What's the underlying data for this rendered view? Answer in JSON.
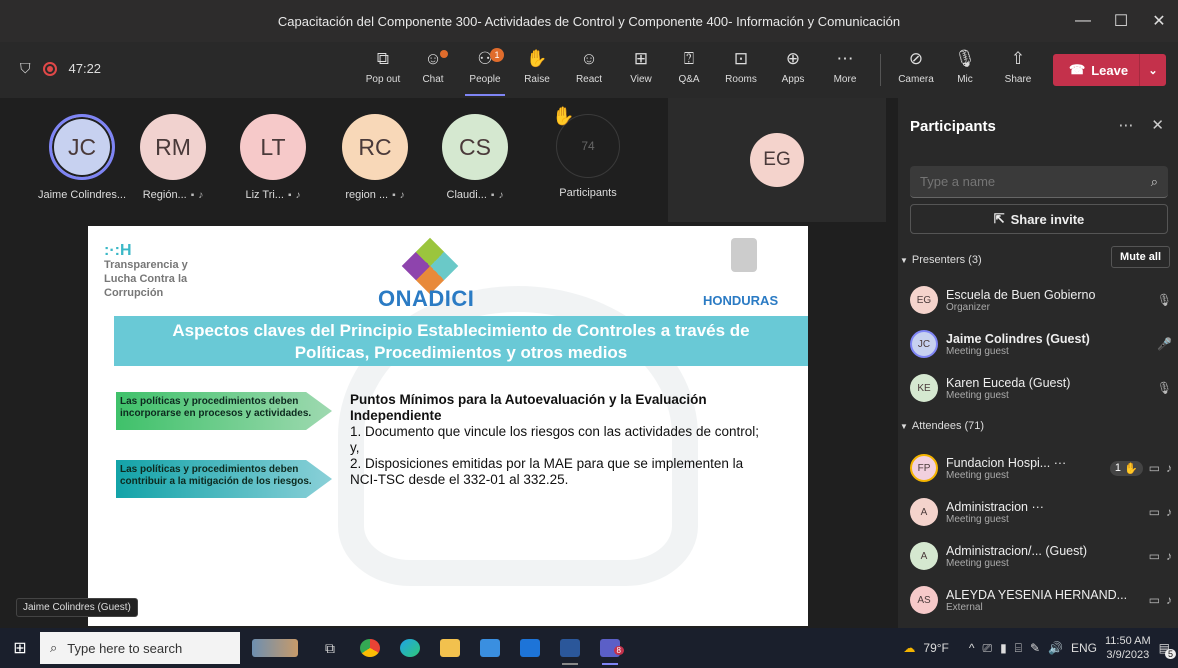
{
  "window": {
    "title": "Capacitación del Componente 300- Actividades de Control y Componente 400- Información y Comunicación",
    "controls": [
      "—",
      "☐",
      "✕"
    ]
  },
  "toolbar": {
    "timer": "47:22",
    "buttons": [
      {
        "label": "Pop out",
        "icon": "pop-out-icon"
      },
      {
        "label": "Chat",
        "icon": "chat-icon"
      },
      {
        "label": "People",
        "icon": "people-icon",
        "badge": "1"
      },
      {
        "label": "Raise",
        "icon": "raise-hand-icon"
      },
      {
        "label": "React",
        "icon": "react-icon"
      },
      {
        "label": "View",
        "icon": "view-icon"
      },
      {
        "label": "Q&A",
        "icon": "qa-icon"
      },
      {
        "label": "Rooms",
        "icon": "rooms-icon"
      },
      {
        "label": "Apps",
        "icon": "apps-icon"
      },
      {
        "label": "More",
        "icon": "more-icon"
      },
      {
        "label": "Camera",
        "icon": "camera-off-icon"
      },
      {
        "label": "Mic",
        "icon": "mic-off-icon"
      },
      {
        "label": "Share",
        "icon": "share-icon"
      }
    ],
    "leave_label": "Leave"
  },
  "tiles": [
    {
      "initials": "JC",
      "name": "Jaime Colindres...",
      "color": "#c7d1f0"
    },
    {
      "initials": "RM",
      "name": "Región...",
      "color": "#f1d2cf"
    },
    {
      "initials": "LT",
      "name": "Liz Tri...",
      "color": "#f6c9c9"
    },
    {
      "initials": "RC",
      "name": "region ...",
      "color": "#f8d8b8"
    },
    {
      "initials": "CS",
      "name": "Claudi...",
      "color": "#d5e8d0"
    }
  ],
  "more_tile": {
    "count": "74",
    "label": "Participants"
  },
  "eg_tile": {
    "initials": "EG",
    "color": "#f4d3cc"
  },
  "slide": {
    "org_mark": ":·:H",
    "org_name": [
      "Transparencia y",
      "Lucha Contra la",
      "Corrupción"
    ],
    "onadici": "ONADICI",
    "honduras": "HONDURAS",
    "banner": [
      "Aspectos claves del Principio Establecimiento de Controles a través de",
      "Políticas, Procedimientos y otros medios"
    ],
    "box1": "Las políticas y procedimientos deben incorporarse en procesos y actividades.",
    "box2": "Las políticas y procedimientos deben contribuir a la mitigación de los riesgos.",
    "heading": "Puntos Mínimos para la Autoevaluación y la Evaluación Independiente",
    "items": [
      "1. Documento que vincule los riesgos con las actividades de control; y,",
      "2. Disposiciones emitidas por la MAE para que se implementen la NCI-TSC desde el 332-01 al 332.25."
    ]
  },
  "speaker_chip": "Jaime Colindres (Guest)",
  "panel": {
    "title": "Participants",
    "search_placeholder": "Type a name",
    "share_invite": "Share invite",
    "presenters_label": "Presenters (3)",
    "mute_all": "Mute all",
    "attendees_label": "Attendees (71)",
    "presenters": [
      {
        "initials": "EG",
        "name": "Escuela de Buen Gobierno",
        "role": "Organizer",
        "color": "#f4d3cc",
        "bold": false,
        "right": "mic-off"
      },
      {
        "initials": "JC",
        "name": "Jaime Colindres (Guest)",
        "role": "Meeting guest",
        "color": "#c7d1f0",
        "bold": true,
        "right": "mic-on"
      },
      {
        "initials": "KE",
        "name": "Karen Euceda (Guest)",
        "role": "Meeting guest",
        "color": "#d5e8d0",
        "bold": false,
        "right": "mic-off"
      }
    ],
    "attendees": [
      {
        "initials": "FP",
        "name": "Fundacion Hospi... ···",
        "role": "Meeting guest",
        "color": "#f1d0df",
        "raise": "1"
      },
      {
        "initials": "A",
        "name": "Administracion ···",
        "role": "Meeting guest",
        "color": "#f4d3cc",
        "raise": ""
      },
      {
        "initials": "A",
        "name": "Administracion/...  (Guest)",
        "role": "Meeting guest",
        "color": "#d5e8d0",
        "raise": ""
      },
      {
        "initials": "AS",
        "name": "ALEYDA YESENIA HERNAND...",
        "role": "External",
        "color": "#f6c9c9",
        "raise": ""
      }
    ]
  },
  "taskbar": {
    "search_placeholder": "Type here to search",
    "weather": "79°F",
    "lang": "ENG",
    "time": "11:50 AM",
    "date": "3/9/2023",
    "notif": "5",
    "teams_badge": "8"
  }
}
